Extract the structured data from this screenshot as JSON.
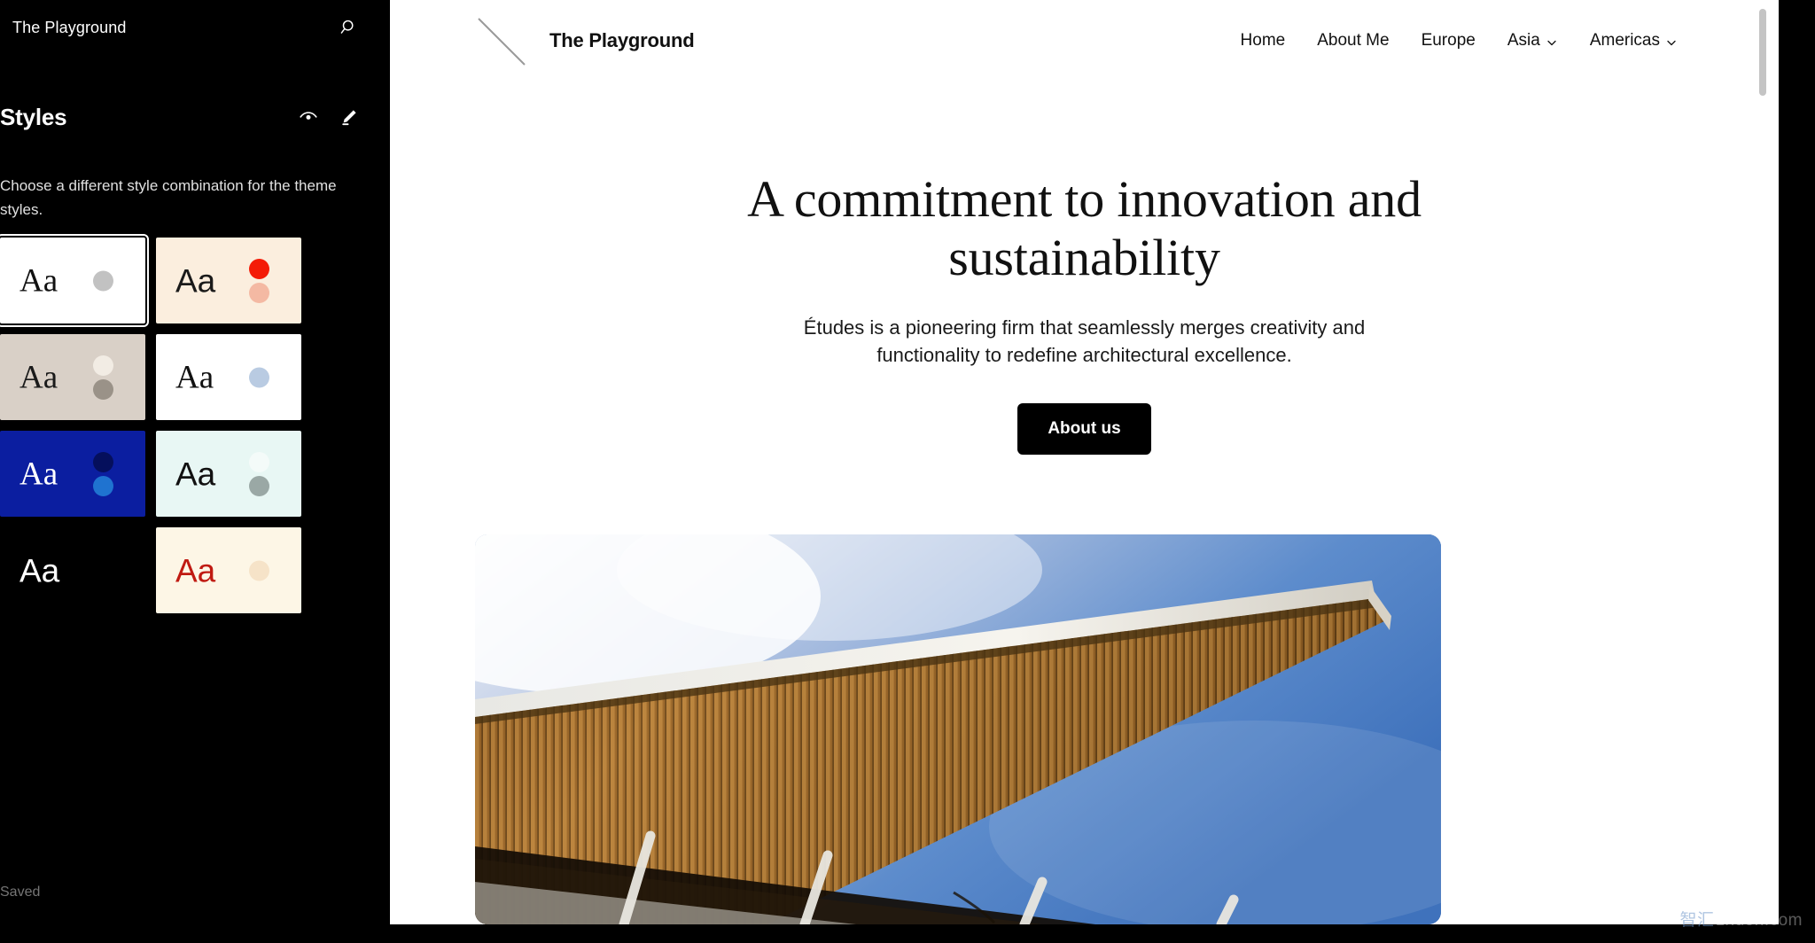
{
  "editor": {
    "site_title": "The Playground",
    "search_icon": "search-icon",
    "panel": {
      "title": "Styles",
      "description": "Choose a different style combination for the theme styles.",
      "eye_icon": "eye-icon",
      "pencil_icon": "pencil-edit-icon"
    },
    "save_status": "Saved",
    "style_variations": [
      {
        "name": "default-light",
        "label": "Aa",
        "bg": "#ffffff",
        "text": "#111111",
        "serif": true,
        "selected": true,
        "dots": [
          "#c2c2c2"
        ]
      },
      {
        "name": "cream-red",
        "label": "Aa",
        "bg": "#fbeede",
        "text": "#1a1a1a",
        "serif": false,
        "selected": false,
        "dots": [
          "#f41b07",
          "#f4b9a3"
        ]
      },
      {
        "name": "warm-taupe",
        "label": "Aa",
        "bg": "#d9d0c7",
        "text": "#1a1a1a",
        "serif": true,
        "selected": false,
        "dots": [
          "#f2ece4",
          "#9a9288"
        ]
      },
      {
        "name": "white-blue",
        "label": "Aa",
        "bg": "#ffffff",
        "text": "#111111",
        "serif": true,
        "selected": false,
        "dots": [
          "#b9cbe2"
        ]
      },
      {
        "name": "deep-blue",
        "label": "Aa",
        "bg": "#0b1ea0",
        "text": "#ffffff",
        "serif": true,
        "selected": false,
        "dots": [
          "#050f5c",
          "#1f73d0"
        ]
      },
      {
        "name": "mint-pale",
        "label": "Aa",
        "bg": "#e8f7f4",
        "text": "#111111",
        "serif": false,
        "selected": false,
        "dots": [
          "#f4fbf9",
          "#9aa8a5"
        ]
      },
      {
        "name": "black-dark",
        "label": "Aa",
        "bg": "#000000",
        "text": "#ffffff",
        "serif": false,
        "selected": false,
        "dots": []
      },
      {
        "name": "ivory-crimson",
        "label": "Aa",
        "bg": "#fdf6e6",
        "text": "#c01a12",
        "serif": false,
        "selected": false,
        "dots": [
          "#f6e3c8"
        ]
      }
    ]
  },
  "site": {
    "brand_name": "The Playground",
    "logo_icon": "diagonal-line-logo",
    "nav": [
      {
        "label": "Home",
        "has_submenu": false
      },
      {
        "label": "About Me",
        "has_submenu": false
      },
      {
        "label": "Europe",
        "has_submenu": false
      },
      {
        "label": "Asia",
        "has_submenu": true
      },
      {
        "label": "Americas",
        "has_submenu": true
      }
    ],
    "hero": {
      "heading": "A commitment to innovation and sustainability",
      "paragraph": "Études is a pioneering firm that seamlessly merges creativity and functionality to redefine architectural excellence.",
      "cta_label": "About us",
      "image_alt": "architectural-canopy-photo"
    }
  },
  "watermark": {
    "cjk": "智汇",
    "domain": "zhuon.com"
  },
  "colors": {
    "editor_background": "#000000",
    "canvas_background": "#ffffff",
    "accent_red": "#f41b07",
    "accent_blue": "#0b1ea0",
    "cta_background": "#000000",
    "cta_text": "#ffffff"
  }
}
